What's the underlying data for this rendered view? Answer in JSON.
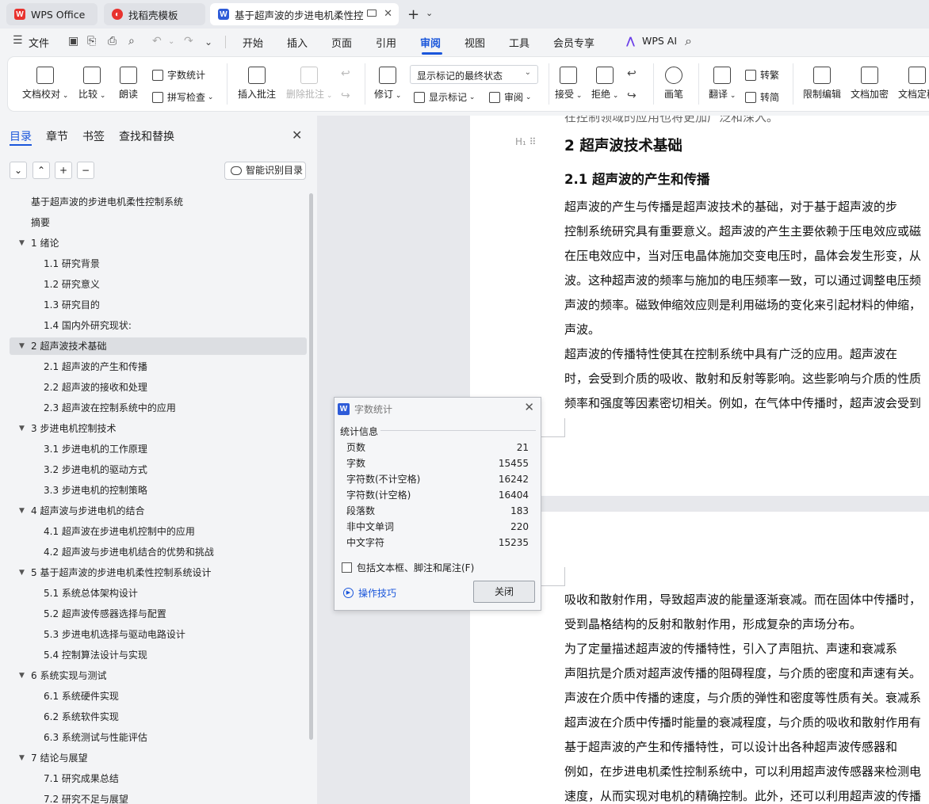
{
  "tabs": [
    {
      "label": "WPS Office"
    },
    {
      "label": "找稻壳模板"
    },
    {
      "label": "基于超声波的步进电机柔性控"
    }
  ],
  "menu": {
    "file": "文件",
    "items": [
      "开始",
      "插入",
      "页面",
      "引用",
      "审阅",
      "视图",
      "工具",
      "会员专享"
    ],
    "active": "审阅",
    "ai": "WPS AI"
  },
  "ribbon": {
    "doc_check": "文档校对",
    "compare": "比较",
    "read_aloud": "朗读",
    "word_count": "字数统计",
    "spell_check": "拼写检查",
    "insert_comment": "插入批注",
    "delete_comment": "删除批注",
    "revise": "修订",
    "markup_state": "显示标记的最终状态",
    "show_markup": "显示标记",
    "review": "审阅",
    "accept": "接受",
    "reject": "拒绝",
    "pen": "画笔",
    "translate": "翻译",
    "to_traditional": "转繁",
    "to_simplified": "转简",
    "restrict_edit": "限制编辑",
    "doc_encrypt": "文档加密",
    "doc_final": "文档定稿"
  },
  "nav": {
    "tabs": [
      "目录",
      "章节",
      "书签",
      "查找和替换"
    ],
    "smart_toc": "智能识别目录",
    "toc": [
      {
        "text": "基于超声波的步进电机柔性控制系统",
        "level": 0,
        "expand": false
      },
      {
        "text": "摘要",
        "level": 0,
        "expand": false
      },
      {
        "text": "1  绪论",
        "level": 1,
        "expand": true
      },
      {
        "text": "1.1  研究背景",
        "level": 2,
        "expand": false
      },
      {
        "text": "1.2  研究意义",
        "level": 2,
        "expand": false
      },
      {
        "text": "1.3  研究目的",
        "level": 2,
        "expand": false
      },
      {
        "text": "1.4 国内外研究现状:",
        "level": 2,
        "expand": false
      },
      {
        "text": "2  超声波技术基础",
        "level": 1,
        "expand": true,
        "selected": true
      },
      {
        "text": "2.1  超声波的产生和传播",
        "level": 2,
        "expand": false
      },
      {
        "text": "2.2  超声波的接收和处理",
        "level": 2,
        "expand": false
      },
      {
        "text": "2.3  超声波在控制系统中的应用",
        "level": 2,
        "expand": false
      },
      {
        "text": "3  步进电机控制技术",
        "level": 1,
        "expand": true
      },
      {
        "text": "3.1  步进电机的工作原理",
        "level": 2,
        "expand": false
      },
      {
        "text": "3.2  步进电机的驱动方式",
        "level": 2,
        "expand": false
      },
      {
        "text": "3.3  步进电机的控制策略",
        "level": 2,
        "expand": false
      },
      {
        "text": "4  超声波与步进电机的结合",
        "level": 1,
        "expand": true
      },
      {
        "text": "4.1  超声波在步进电机控制中的应用",
        "level": 2,
        "expand": false
      },
      {
        "text": "4.2  超声波与步进电机结合的优势和挑战",
        "level": 2,
        "expand": false
      },
      {
        "text": "5  基于超声波的步进电机柔性控制系统设计",
        "level": 1,
        "expand": true
      },
      {
        "text": "5.1  系统总体架构设计",
        "level": 2,
        "expand": false
      },
      {
        "text": "5.2  超声波传感器选择与配置",
        "level": 2,
        "expand": false
      },
      {
        "text": "5.3  步进电机选择与驱动电路设计",
        "level": 2,
        "expand": false
      },
      {
        "text": "5.4  控制算法设计与实现",
        "level": 2,
        "expand": false
      },
      {
        "text": "6  系统实现与测试",
        "level": 1,
        "expand": true
      },
      {
        "text": "6.1  系统硬件实现",
        "level": 2,
        "expand": false
      },
      {
        "text": "6.2  系统软件实现",
        "level": 2,
        "expand": false
      },
      {
        "text": "6.3  系统测试与性能评估",
        "level": 2,
        "expand": false
      },
      {
        "text": "7  结论与展望",
        "level": 1,
        "expand": true
      },
      {
        "text": "7.1  研究成果总结",
        "level": 2,
        "expand": false
      },
      {
        "text": "7.2  研究不足与展望",
        "level": 2,
        "expand": false
      }
    ]
  },
  "doc": {
    "top_cut": "在控制领域的应用也将更加广泛和深入。",
    "heading1": "2  超声波技术基础",
    "heading2": "2.1  超声波的产生和传播",
    "page1_lines": [
      "      超声波的产生与传播是超声波技术的基础，对于基于超声波的步",
      "控制系统研究具有重要意义。超声波的产生主要依赖于压电效应或磁",
      "在压电效应中，当对压电晶体施加交变电压时，晶体会发生形变，从",
      "波。这种超声波的频率与施加的电压频率一致，可以通过调整电压频",
      "声波的频率。磁致伸缩效应则是利用磁场的变化来引起材料的伸缩，",
      "声波。",
      "      超声波的传播特性使其在控制系统中具有广泛的应用。超声波在",
      "时，会受到介质的吸收、散射和反射等影响。这些影响与介质的性质",
      "频率和强度等因素密切相关。例如，在气体中传播时，超声波会受到"
    ],
    "page2_lines": [
      "吸收和散射作用，导致超声波的能量逐渐衰减。而在固体中传播时，",
      "受到晶格结构的反射和散射作用，形成复杂的声场分布。",
      "      为了定量描述超声波的传播特性，引入了声阻抗、声速和衰减系",
      "声阻抗是介质对超声波传播的阻碍程度，与介质的密度和声速有关。",
      "声波在介质中传播的速度，与介质的弹性和密度等性质有关。衰减系",
      "超声波在介质中传播时能量的衰减程度，与介质的吸收和散射作用有",
      "      基于超声波的产生和传播特性，可以设计出各种超声波传感器和",
      "例如，在步进电机柔性控制系统中，可以利用超声波传感器来检测电",
      "速度，从而实现对电机的精确控制。此外，还可以利用超声波的传播"
    ]
  },
  "dialog": {
    "title": "字数统计",
    "section": "统计信息",
    "stats": [
      {
        "label": "页数",
        "value": "21"
      },
      {
        "label": "字数",
        "value": "15455"
      },
      {
        "label": "字符数(不计空格)",
        "value": "16242"
      },
      {
        "label": "字符数(计空格)",
        "value": "16404"
      },
      {
        "label": "段落数",
        "value": "183"
      },
      {
        "label": "非中文单词",
        "value": "220"
      },
      {
        "label": "中文字符",
        "value": "15235"
      }
    ],
    "checkbox_label": "包括文本框、脚注和尾注(F)",
    "checkbox_checked": false,
    "tips": "操作技巧",
    "close_button": "关闭"
  },
  "colors": {
    "accent": "#1a56db",
    "wps_red": "#e8322e",
    "wps_blue": "#2e5bd8"
  }
}
